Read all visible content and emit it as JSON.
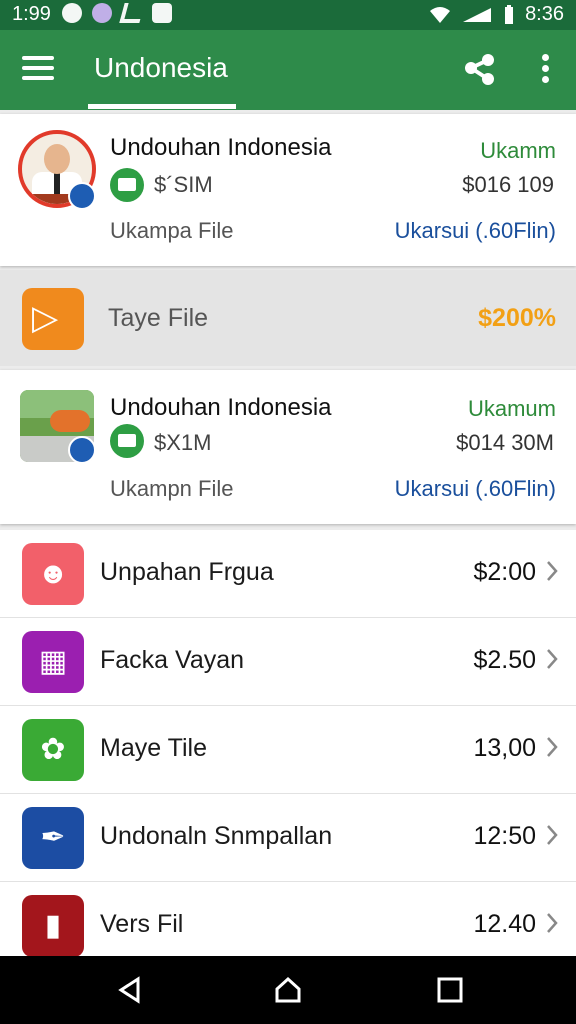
{
  "status_bar": {
    "time_left": "1:99",
    "time_right": "8:36"
  },
  "app_bar": {
    "title": "Undonesia"
  },
  "cards": [
    {
      "title": "Undouhan Indonesia",
      "sub": "$´SIM",
      "file": "Ukampa File",
      "status": "Ukamm",
      "amount": "$016 109",
      "link": "Ukarsui (.60Flin)"
    },
    {
      "title": "Undouhan Indonesia",
      "sub": "$X1M",
      "file": "Ukampn File",
      "status": "Ukamum",
      "amount": "$014 30M",
      "link": "Ukarsui (.60Flin)"
    }
  ],
  "band": {
    "label": "Taye File",
    "percent": "$200%"
  },
  "list": [
    {
      "label": "Unpahan Frgua",
      "value": "$2:00",
      "icon": "person-icon",
      "color": "#f2606a"
    },
    {
      "label": "Facka Vayan",
      "value": "$2.50",
      "icon": "chart-icon",
      "color": "#9b1fb0"
    },
    {
      "label": "Maye Tile",
      "value": "13,00",
      "icon": "leaf-icon",
      "color": "#3aaa35"
    },
    {
      "label": "Undonaln Snmpallan",
      "value": "12:50",
      "icon": "pen-icon",
      "color": "#1c4da3"
    },
    {
      "label": "Vers Fil",
      "value": "12.40",
      "icon": "door-icon",
      "color": "#a3161c"
    }
  ],
  "colors": {
    "status_bar": "#1b6b3a",
    "app_bar": "#2e8b4a",
    "accent_orange": "#f2a015",
    "link_blue": "#1a4f9c"
  }
}
